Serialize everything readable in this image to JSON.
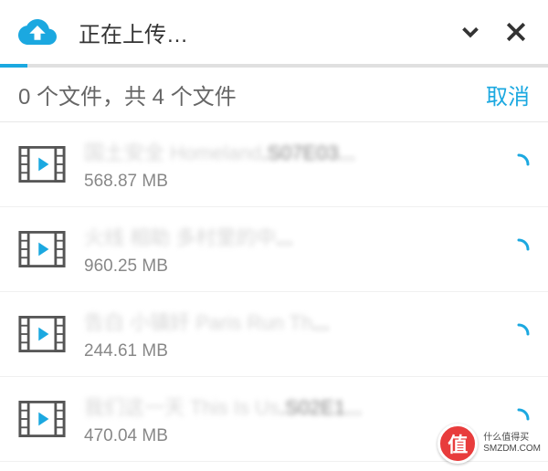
{
  "header": {
    "title": "正在上传…"
  },
  "subheader": {
    "status": "0 个文件，共 4 个文件",
    "cancel_label": "取消"
  },
  "files": [
    {
      "name_obscured": "国土安全 Homeland",
      "name_clear": ".S07E03...",
      "size": "568.87 MB"
    },
    {
      "name_obscured": "火线 相助 多村里的中",
      "name_clear": "...",
      "size": "960.25 MB"
    },
    {
      "name_obscured": "告白 小镇奸 Paris Run Th",
      "name_clear": "...",
      "size": "244.61 MB"
    },
    {
      "name_obscured": "我们这一天 This Is Us",
      "name_clear": ".S02E1...",
      "size": "470.04 MB"
    }
  ],
  "watermark": {
    "badge": "值",
    "line1": "什么值得买",
    "line2": "SMZDM.COM"
  }
}
